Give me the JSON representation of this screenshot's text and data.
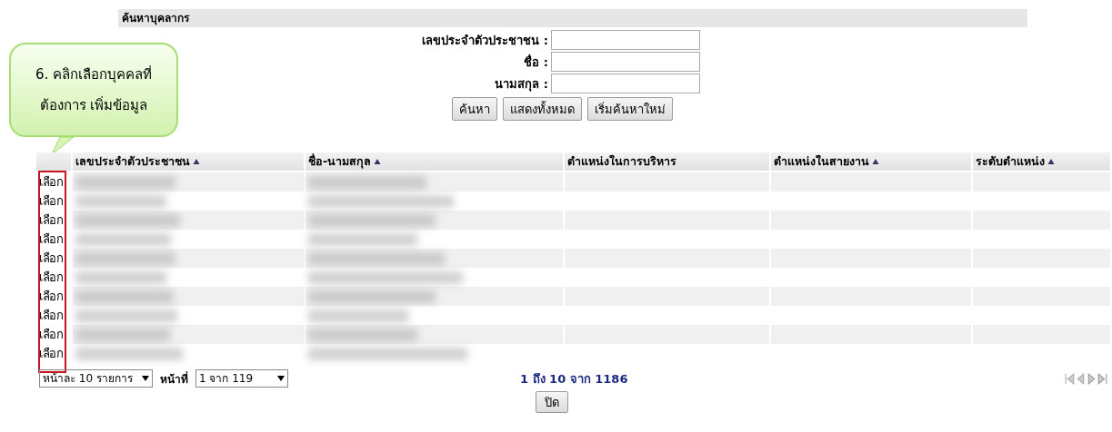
{
  "search_panel": {
    "title": "ค้นหาบุคลากร",
    "fields": [
      {
        "label": "เลขประจำตัวประชาชน :"
      },
      {
        "label": "ชื่อ :"
      },
      {
        "label": "นามสกุล :"
      }
    ],
    "buttons": [
      "ค้นหา",
      "แสดงทั้งหมด",
      "เริ่มค้นหาใหม่"
    ]
  },
  "callout": {
    "lines": [
      "6. คลิกเลือกบุคคลที่",
      "ต้องการ เพิ่มข้อมูล"
    ]
  },
  "table": {
    "select_column_highlighted": true,
    "columns": [
      {
        "label": "เลขประจำตัวประชาชน",
        "sortable": true
      },
      {
        "label": "ชื่อ-นามสกุล",
        "sortable": true
      },
      {
        "label": "ตำแหน่งในการบริหาร",
        "sortable": false
      },
      {
        "label": "ตำแหน่งในสายงาน",
        "sortable": true
      },
      {
        "label": "ระดับตำแหน่ง",
        "sortable": true
      }
    ],
    "rows": [
      {
        "select": "เลือก"
      },
      {
        "select": "เลือก"
      },
      {
        "select": "เลือก"
      },
      {
        "select": "เลือก"
      },
      {
        "select": "เลือก"
      },
      {
        "select": "เลือก"
      },
      {
        "select": "เลือก"
      },
      {
        "select": "เลือก"
      },
      {
        "select": "เลือก"
      },
      {
        "select": "เลือก"
      }
    ]
  },
  "pager": {
    "page_size": "หน้าละ 10 รายการ",
    "page_label": "หน้าที่",
    "page": "1 จาก 119",
    "summary": "1 ถึง 10 จาก 1186"
  },
  "close_button": "ปิด"
}
